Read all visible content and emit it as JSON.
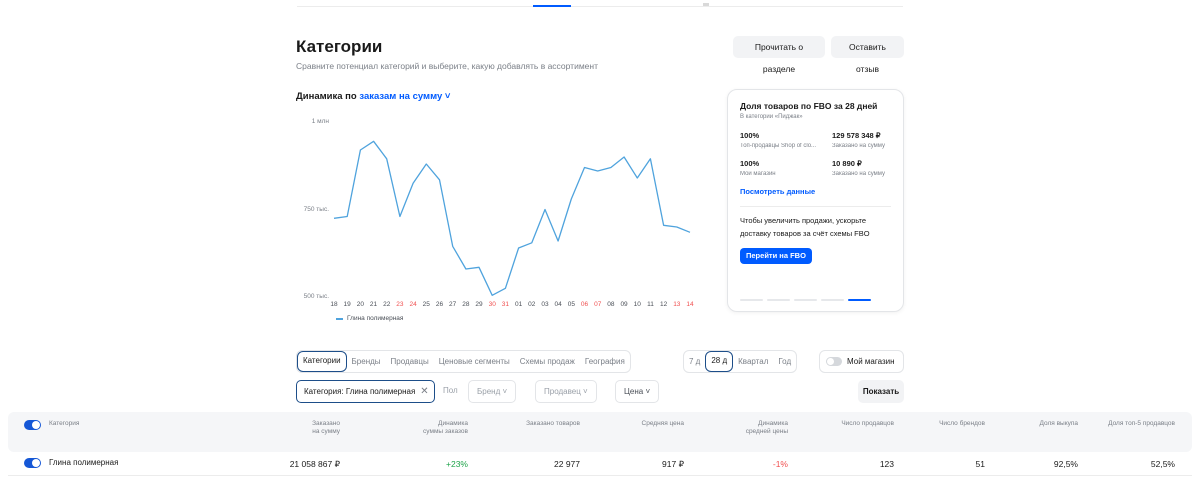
{
  "header": {
    "title": "Категории",
    "subtitle": "Сравните потенциал категорий и выберите, какую добавлять в ассортимент",
    "read_button": "Прочитать о разделе",
    "review_button": "Оставить отзыв"
  },
  "dynamics": {
    "prefix": "Динамика по ",
    "metric": "заказам на сумму",
    "chevron": "˅"
  },
  "chart_data": {
    "type": "line",
    "title": "",
    "xlabel": "",
    "ylabel": "",
    "ylim": [
      500000,
      1000000
    ],
    "yticks": [
      {
        "value": 1000000,
        "label": "1 млн"
      },
      {
        "value": 750000,
        "label": "750 тыс."
      },
      {
        "value": 500000,
        "label": "500 тыс."
      }
    ],
    "categories": [
      "18",
      "19",
      "20",
      "21",
      "22",
      "23",
      "24",
      "25",
      "26",
      "27",
      "28",
      "29",
      "30",
      "31",
      "01",
      "02",
      "03",
      "04",
      "05",
      "06",
      "07",
      "08",
      "09",
      "10",
      "11",
      "12",
      "13",
      "14"
    ],
    "weekend": [
      false,
      false,
      false,
      false,
      false,
      true,
      true,
      false,
      false,
      false,
      false,
      false,
      true,
      true,
      false,
      false,
      false,
      false,
      false,
      true,
      true,
      false,
      false,
      false,
      false,
      false,
      true,
      true
    ],
    "series": [
      {
        "name": "Глина полимерная",
        "color": "#4fa3dd",
        "values": [
          725000,
          730000,
          920000,
          945000,
          895000,
          730000,
          825000,
          880000,
          835000,
          645000,
          580000,
          585000,
          505000,
          525000,
          640000,
          655000,
          750000,
          660000,
          780000,
          870000,
          860000,
          870000,
          900000,
          840000,
          895000,
          705000,
          700000,
          685000
        ]
      }
    ],
    "legend": "bottom-left",
    "grid": false
  },
  "fbo_card": {
    "title": "Доля товаров по FBO за 28 дней",
    "subtitle": "В категории «Пиджак»",
    "stats": [
      {
        "value": "100%",
        "label": "Топ-продавцы Shop of clo..."
      },
      {
        "value": "129 578 348 ₽",
        "label": "Заказано на сумму"
      },
      {
        "value": "100%",
        "label": "Мой магазин"
      },
      {
        "value": "10 890 ₽",
        "label": "Заказано на сумму"
      }
    ],
    "link": "Посмотреть данные",
    "promo_text": "Чтобы увеличить продажи, ускорьте доставку товаров за счёт схемы FBO",
    "button": "Перейти на FBO"
  },
  "tabs": [
    "Категории",
    "Бренды",
    "Продавцы",
    "Ценовые сегменты",
    "Схемы продаж",
    "География"
  ],
  "periods": [
    "7 д",
    "28 д",
    "Квартал",
    "Год"
  ],
  "my_store_label": "Мой магазин",
  "filters": {
    "chip": "Категория: Глина полимерная",
    "chip_close": "✕",
    "floor": "Пол",
    "brand": "Бренд",
    "seller": "Продавец",
    "price": "Цена",
    "show": "Показать"
  },
  "table": {
    "headers": {
      "category": "Категория",
      "ordered_sum": [
        "Заказано",
        "на сумму"
      ],
      "dyn_sum": [
        "Динамика",
        "суммы заказов"
      ],
      "ordered_items": "Заказано товаров",
      "avg_price": "Средняя цена",
      "dyn_avg": [
        "Динамика",
        "средней цены"
      ],
      "sellers": "Число продавцов",
      "brands": "Число брендов",
      "buyout": "Доля выкупа",
      "top5": "Доля топ-5 продавцов"
    },
    "row": {
      "category": "Глина полимерная",
      "ordered_sum": "21 058 867 ₽",
      "dyn_sum": "+23%",
      "ordered_items": "22 977",
      "avg_price": "917 ₽",
      "dyn_avg": "-1%",
      "sellers": "123",
      "brands": "51",
      "buyout": "92,5%",
      "top5": "52,5%"
    }
  }
}
